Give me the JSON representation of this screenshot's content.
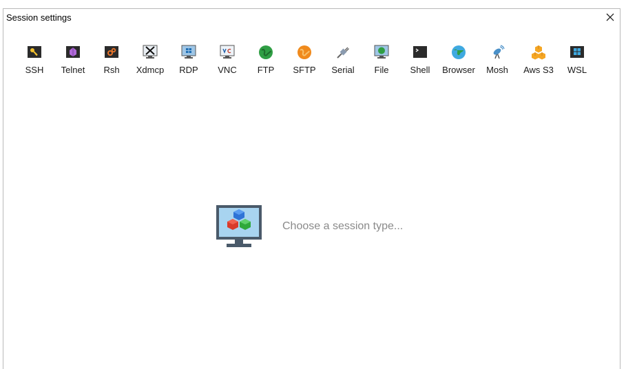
{
  "window": {
    "title": "Session settings"
  },
  "toolbar": {
    "items": [
      {
        "label": "SSH",
        "icon": "ssh-icon"
      },
      {
        "label": "Telnet",
        "icon": "telnet-icon"
      },
      {
        "label": "Rsh",
        "icon": "rsh-icon"
      },
      {
        "label": "Xdmcp",
        "icon": "xdmcp-icon"
      },
      {
        "label": "RDP",
        "icon": "rdp-icon"
      },
      {
        "label": "VNC",
        "icon": "vnc-icon"
      },
      {
        "label": "FTP",
        "icon": "ftp-icon"
      },
      {
        "label": "SFTP",
        "icon": "sftp-icon"
      },
      {
        "label": "Serial",
        "icon": "serial-icon"
      },
      {
        "label": "File",
        "icon": "file-icon"
      },
      {
        "label": "Shell",
        "icon": "shell-icon"
      },
      {
        "label": "Browser",
        "icon": "browser-icon"
      },
      {
        "label": "Mosh",
        "icon": "mosh-icon"
      },
      {
        "label": "Aws S3",
        "icon": "aws-s3-icon"
      },
      {
        "label": "WSL",
        "icon": "wsl-icon"
      }
    ]
  },
  "main": {
    "prompt": "Choose a session type..."
  },
  "colors": {
    "dark_tile": "#2b2b2b",
    "globe_green": "#2f9e44",
    "globe_orange": "#f08a1c",
    "monitor_blue": "#4a90c8",
    "aws_orange": "#f5a623"
  }
}
